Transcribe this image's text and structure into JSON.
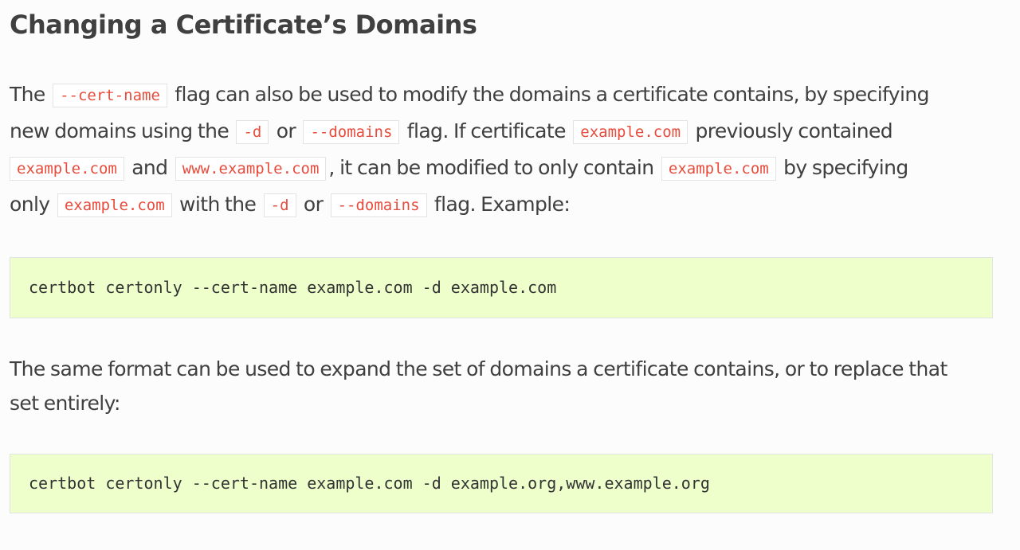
{
  "heading": "Changing a Certificate’s Domains",
  "paragraph1": {
    "l1_t1": "The",
    "l1_c1": "--cert-name",
    "l1_t2": "flag can also be used to modify the domains a certificate contains, by specifying",
    "l2_t1": "new domains using the",
    "l2_c1": "-d",
    "l2_t2": "or",
    "l2_c2": "--domains",
    "l2_t3": "flag. If certificate",
    "l2_c3": "example.com",
    "l2_t4": "previously contained",
    "l3_c1": "example.com",
    "l3_t1": "and",
    "l3_c2": "www.example.com",
    "l3_t2": ", it can be modified to only contain",
    "l3_c3": "example.com",
    "l3_t3": "by specifying",
    "l4_t1": "only",
    "l4_c1": "example.com",
    "l4_t2": "with the",
    "l4_c2": "-d",
    "l4_t3": "or",
    "l4_c3": "--domains",
    "l4_t4": "flag. Example:"
  },
  "code_block_1": "certbot certonly --cert-name example.com -d example.com",
  "paragraph2": {
    "l1": "The same format can be used to expand the set of domains a certificate contains, or to replace that",
    "l2": "set entirely:"
  },
  "code_block_2": "certbot certonly --cert-name example.com -d example.org,www.example.org"
}
